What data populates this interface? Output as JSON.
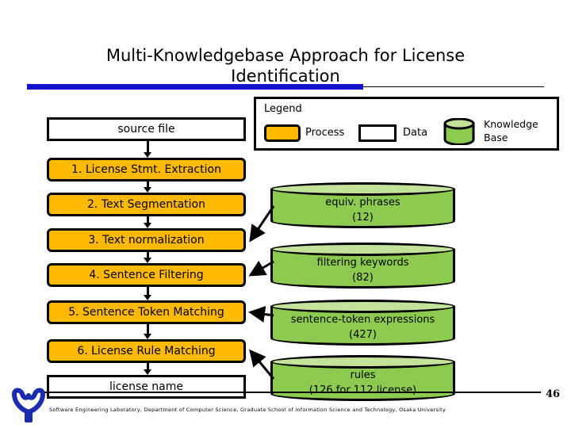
{
  "slide": {
    "title": "Multi-Knowledgebase Approach for License\nIdentification",
    "page_number": "46",
    "footer": "Software Engineering Laboratory, Department of Computer Science, Graduate School of Information Science and Technology, Osaka University",
    "colors": {
      "process_fill": "#FFB900",
      "knowledgebase_fill": "#8DCB50",
      "knowledgebase_top": "#C3E39B",
      "data_fill": "#FFFFFF",
      "rule_blue": "#1414CE",
      "outline": "#000000"
    }
  },
  "legend": {
    "title": "Legend",
    "items": [
      {
        "shape": "rounded-rect",
        "fill": "#FFB900",
        "label": "Process"
      },
      {
        "shape": "rect",
        "fill": "#FFFFFF",
        "label": "Data"
      },
      {
        "shape": "cylinder",
        "fill": "#8DCB50",
        "label": "Knowledge\nBase"
      }
    ]
  },
  "flow": {
    "nodes": [
      {
        "id": "source-file",
        "kind": "data",
        "label": "source file"
      },
      {
        "id": "step-1",
        "kind": "process",
        "label": "1. License Stmt. Extraction"
      },
      {
        "id": "step-2",
        "kind": "process",
        "label": "2. Text Segmentation"
      },
      {
        "id": "step-3",
        "kind": "process",
        "label": "3. Text normalization"
      },
      {
        "id": "step-4",
        "kind": "process",
        "label": "4. Sentence Filtering"
      },
      {
        "id": "step-5",
        "kind": "process",
        "label": "5. Sentence Token Matching"
      },
      {
        "id": "step-6",
        "kind": "process",
        "label": "6. License Rule Matching"
      },
      {
        "id": "license-name",
        "kind": "data",
        "label": "license name"
      }
    ]
  },
  "knowledgebases": [
    {
      "id": "kb-equiv-phrases",
      "name": "equiv. phrases",
      "count": "(12)",
      "feeds": "3. Text normalization"
    },
    {
      "id": "kb-filter-keywords",
      "name": "filtering keywords",
      "count": "(82)",
      "feeds": "4. Sentence Filtering"
    },
    {
      "id": "kb-sentence-tokens",
      "name": "sentence-token expressions",
      "count": "(427)",
      "feeds": "5. Sentence Token Matching"
    },
    {
      "id": "kb-rules",
      "name": "rules",
      "count": "(126 for 112 license)",
      "feeds": "6. License Rule Matching"
    }
  ]
}
